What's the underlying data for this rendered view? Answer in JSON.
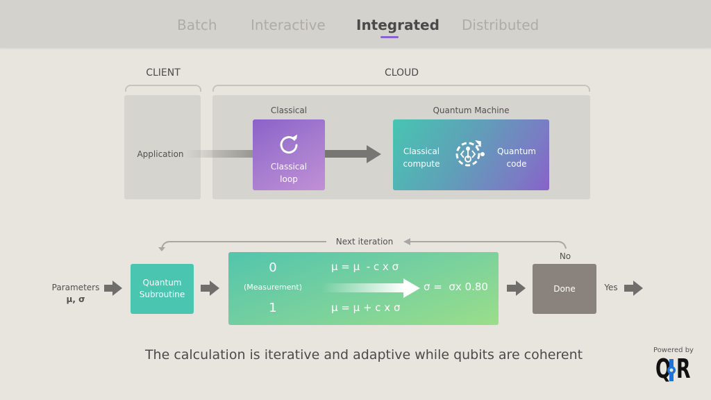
{
  "nav": {
    "tabs": [
      {
        "label": "Batch",
        "active": false
      },
      {
        "label": "Interactive",
        "active": false
      },
      {
        "label": "Integrated",
        "active": true
      },
      {
        "label": "Distributed",
        "active": false
      }
    ],
    "accent_color": "#8a63d2"
  },
  "architecture": {
    "client_label": "CLIENT",
    "cloud_label": "CLOUD",
    "application_label": "Application",
    "classical_label": "Classical",
    "classical_loop": {
      "icon": "refresh-icon",
      "line1": "Classical",
      "line2": "loop"
    },
    "quantum_machine_label": "Quantum Machine",
    "quantum_box": {
      "left_line1": "Classical",
      "left_line2": "compute",
      "icon": "quantum-code-icon",
      "right_line1": "Quantum",
      "right_line2": "code"
    }
  },
  "flow": {
    "parameters_label": "Parameters",
    "parameters_symbols": "μ, σ",
    "next_iteration_label": "Next iteration",
    "quantum_subroutine": {
      "line1": "Quantum",
      "line2": "Subroutine"
    },
    "measurement": {
      "zero": "0",
      "label": "(Measurement)",
      "one": "1",
      "rule_zero": "μ = μ  - c x σ",
      "rule_one": "μ = μ + c x σ",
      "sigma_update": "σ =  σx 0.80"
    },
    "done_label": "Done",
    "no_label": "No",
    "yes_label": "Yes"
  },
  "caption": "The calculation is iterative and adaptive while qubits are coherent",
  "branding": {
    "powered_by": "Powered by",
    "logo_text_left": "Q",
    "logo_text_right": "R"
  },
  "colors": {
    "purple": "#8a63d2",
    "teal": "#4ac6b0",
    "green": "#9bdc88",
    "done_gray": "#8a827c"
  }
}
